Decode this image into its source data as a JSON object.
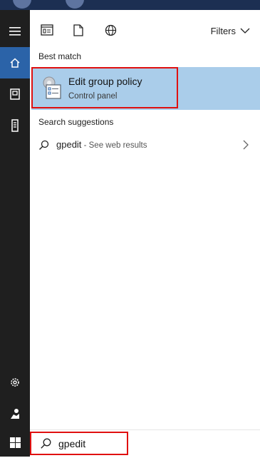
{
  "toolbar": {
    "icons": [
      "apps-icon",
      "documents-icon",
      "web-icon"
    ],
    "filters_label": "Filters"
  },
  "rail": {
    "items": [
      "hamburger-menu-icon",
      "home-icon",
      "notebook-icon",
      "tower-icon",
      "gear-icon",
      "user-icon",
      "windows-start-icon"
    ],
    "active": "home-icon"
  },
  "results": {
    "best_match_heading": "Best match",
    "best_match": {
      "title": "Edit group policy",
      "subtitle": "Control panel",
      "icon": "group-policy-icon"
    },
    "suggestions_heading": "Search suggestions",
    "suggestions": [
      {
        "query": "gpedit",
        "hint": " - See web results"
      }
    ]
  },
  "search": {
    "value": "gpedit"
  },
  "colors": {
    "accent": "#2b63a8",
    "highlight": "#aacdea",
    "callout": "#e01010",
    "rail": "#1f1f1f"
  }
}
